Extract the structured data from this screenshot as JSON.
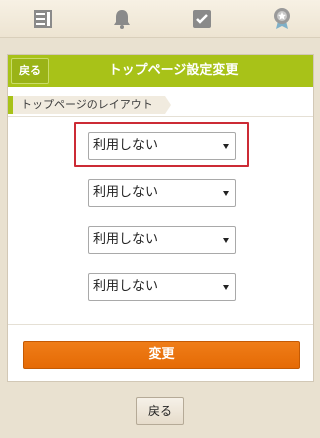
{
  "topbar": {
    "icons": [
      "list-icon",
      "bell-icon",
      "checkbox-icon",
      "badge-icon"
    ]
  },
  "header": {
    "back_label": "戻る",
    "title": "トップページ設定変更"
  },
  "section": {
    "label": "トップページのレイアウト"
  },
  "selects": [
    {
      "value": "利用しない",
      "highlighted": true
    },
    {
      "value": "利用しない",
      "highlighted": false
    },
    {
      "value": "利用しない",
      "highlighted": false
    },
    {
      "value": "利用しない",
      "highlighted": false
    }
  ],
  "submit_label": "変更",
  "footer": {
    "back_label": "戻る"
  },
  "colors": {
    "header_green": "#a8c218",
    "submit_orange": "#e8720a",
    "highlight_red": "#cc2b35",
    "background": "#e9e1d0"
  }
}
